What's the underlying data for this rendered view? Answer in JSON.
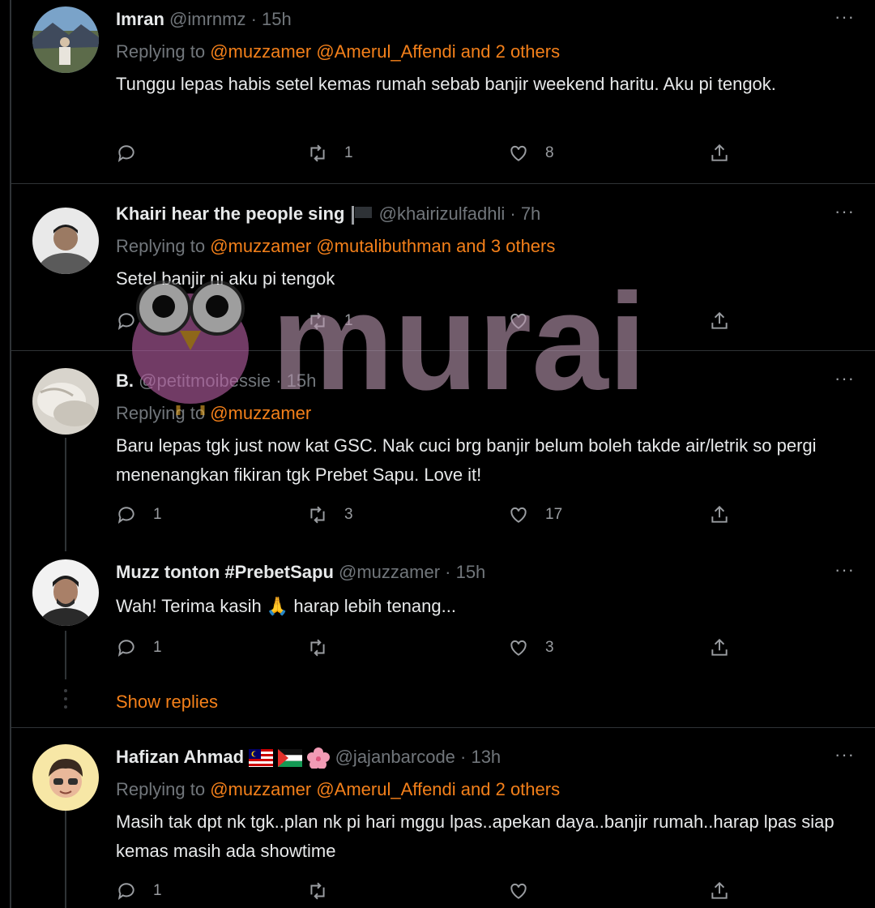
{
  "tweets": [
    {
      "name": "Imran",
      "handle": "@imrnmz · 15h",
      "replying_prefix": "Replying to ",
      "replying_to": "@muzzamer @Amerul_Affendi and 2 others",
      "text": "Tunggu lepas habis setel kemas rumah sebab banjir weekend haritu. Aku pi tengok.",
      "reply_count": "",
      "retweet_count": "1",
      "like_count": "8"
    },
    {
      "name": "Khairi hear the people sing",
      "handle": "@khairizulfadhli · 7h",
      "replying_prefix": "Replying to ",
      "replying_to": "@muzzamer @mutalibuthman and 3 others",
      "text": "Setel banjir ni aku pi tengok",
      "reply_count": "",
      "retweet_count": "1",
      "like_count": ""
    },
    {
      "name": "B.",
      "handle": "@petitmoibessie · 15h",
      "replying_prefix": "Replying to ",
      "replying_to": "@muzzamer",
      "text": "Baru lepas tgk just now kat GSC. Nak cuci brg banjir belum boleh takde air/letrik so pergi menenangkan fikiran tgk Prebet Sapu. Love it!",
      "reply_count": "1",
      "retweet_count": "3",
      "like_count": "17"
    },
    {
      "name": "Muzz tonton #PrebetSapu",
      "handle": "@muzzamer · 15h",
      "text_before": "Wah! Terima kasih ",
      "text_emoji": "🙏",
      "text_after": " harap lebih tenang...",
      "reply_count": "1",
      "retweet_count": "",
      "like_count": "3"
    },
    {
      "name": "Hafizan Ahmad",
      "handle": "@jajanbarcode · 13h",
      "replying_prefix": "Replying to ",
      "replying_to": "@muzzamer @Amerul_Affendi and 2 others",
      "text": "Masih tak dpt nk tgk..plan nk pi hari mggu lpas..apekan daya..banjir rumah..harap lpas siap kemas masih ada showtime",
      "reply_count": "1",
      "retweet_count": "",
      "like_count": ""
    }
  ],
  "show_replies": "Show replies",
  "more_label": "···",
  "watermark_text": "murai",
  "colors": {
    "background": "#000000",
    "accent": "#f4801a",
    "muted": "#71767b",
    "divider": "#2f3336",
    "watermark": "#b07aa0"
  },
  "icons": [
    "reply-icon",
    "retweet-icon",
    "like-icon",
    "share-icon",
    "more-icon",
    "flag-icon"
  ]
}
